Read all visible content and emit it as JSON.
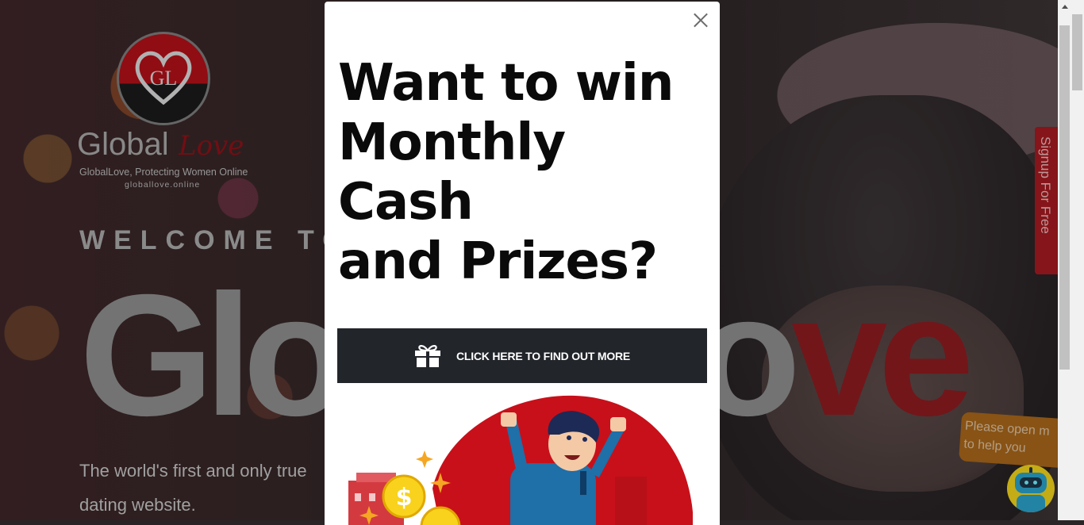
{
  "hero": {
    "logo_word": "Global",
    "logo_script": "Love",
    "logo_monogram": "GL",
    "logo_tagline": "GlobalLove, Protecting Women Online",
    "logo_url": "globallove.online",
    "welcome_text": "WELCOME TO",
    "big_word_part1": "Glob",
    "big_word_part2": "al Lo",
    "big_word_part3": "ve",
    "tagline_line1": "The world's first and only true",
    "tagline_line2": "dating website."
  },
  "signup_tab": {
    "label": "Signup For Free"
  },
  "chat_helper": {
    "bubble_line1": "Please open m",
    "bubble_line2": "to help you",
    "bot_icon": "robot-avatar-icon"
  },
  "modal": {
    "headline_lines": [
      "Want to win",
      "Monthly",
      "Cash",
      "and Prizes?"
    ],
    "cta_label": "CLICK HERE TO FIND OUT MORE",
    "cta_icon": "gift-icon",
    "close_icon": "close-icon",
    "illustration": "winner-with-coins-illustration"
  },
  "colors": {
    "brand_red": "#a31a20",
    "cta_background": "#22252a",
    "helper_bubble": "#a6661a",
    "bot_yellow": "#f0d21c"
  }
}
